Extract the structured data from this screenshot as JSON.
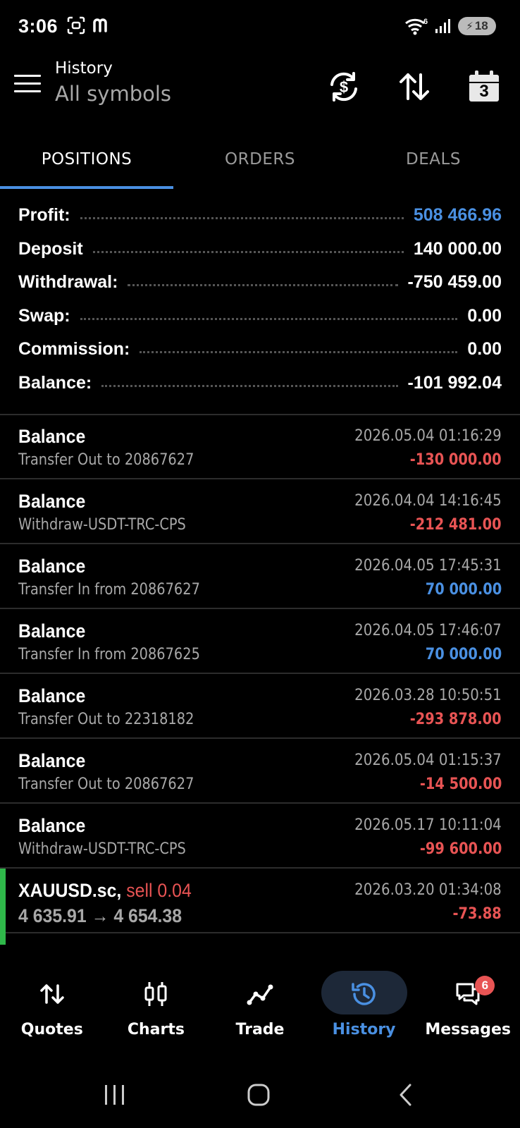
{
  "status_bar": {
    "time": "3:06",
    "network_label": "6",
    "battery": "18"
  },
  "header": {
    "title": "History",
    "subtitle": "All symbols",
    "calendar_day": "3"
  },
  "tabs": [
    {
      "label": "POSITIONS",
      "active": true
    },
    {
      "label": "ORDERS",
      "active": false
    },
    {
      "label": "DEALS",
      "active": false
    }
  ],
  "summary": {
    "profit": {
      "label": "Profit:",
      "value": "508 466.96"
    },
    "deposit": {
      "label": "Deposit",
      "value": "140 000.00"
    },
    "withdrawal": {
      "label": "Withdrawal:",
      "value": "-750 459.00"
    },
    "swap": {
      "label": "Swap:",
      "value": "0.00"
    },
    "commission": {
      "label": "Commission:",
      "value": "0.00"
    },
    "balance": {
      "label": "Balance:",
      "value": "-101 992.04"
    }
  },
  "deals": [
    {
      "title": "Balance",
      "comment": "Transfer Out to 20867627",
      "time": "2026.05.04 01:16:29",
      "amount": "-130 000.00",
      "sign": "negative"
    },
    {
      "title": "Balance",
      "comment": "Withdraw-USDT-TRC-CPS",
      "time": "2026.04.04 14:16:45",
      "amount": "-212 481.00",
      "sign": "negative"
    },
    {
      "title": "Balance",
      "comment": "Transfer In from 20867627",
      "time": "2026.04.05 17:45:31",
      "amount": "70 000.00",
      "sign": "positive"
    },
    {
      "title": "Balance",
      "comment": "Transfer In from 20867625",
      "time": "2026.04.05 17:46:07",
      "amount": "70 000.00",
      "sign": "positive"
    },
    {
      "title": "Balance",
      "comment": "Transfer Out to 22318182",
      "time": "2026.03.28 10:50:51",
      "amount": "-293 878.00",
      "sign": "negative"
    },
    {
      "title": "Balance",
      "comment": "Transfer Out to 20867627",
      "time": "2026.05.04 01:15:37",
      "amount": "-14 500.00",
      "sign": "negative"
    },
    {
      "title": "Balance",
      "comment": "Withdraw-USDT-TRC-CPS",
      "time": "2026.05.17 10:11:04",
      "amount": "-99 600.00",
      "sign": "negative"
    }
  ],
  "trade": {
    "symbol": "XAUUSD.sc,",
    "side": "sell 0.04",
    "prices": "4 635.91 → 4 654.38",
    "time": "2026.03.20 01:34:08",
    "profit": "-73.88"
  },
  "bottom_nav": [
    {
      "label": "Quotes",
      "icon": "quotes-icon"
    },
    {
      "label": "Charts",
      "icon": "charts-icon"
    },
    {
      "label": "Trade",
      "icon": "trade-icon"
    },
    {
      "label": "History",
      "icon": "history-icon",
      "active": true
    },
    {
      "label": "Messages",
      "icon": "messages-icon",
      "badge": "6"
    }
  ],
  "colors": {
    "accent": "#4a90e2",
    "negative": "#e85454",
    "positive": "#4a90e2",
    "buy_bar": "#2fb84a"
  }
}
